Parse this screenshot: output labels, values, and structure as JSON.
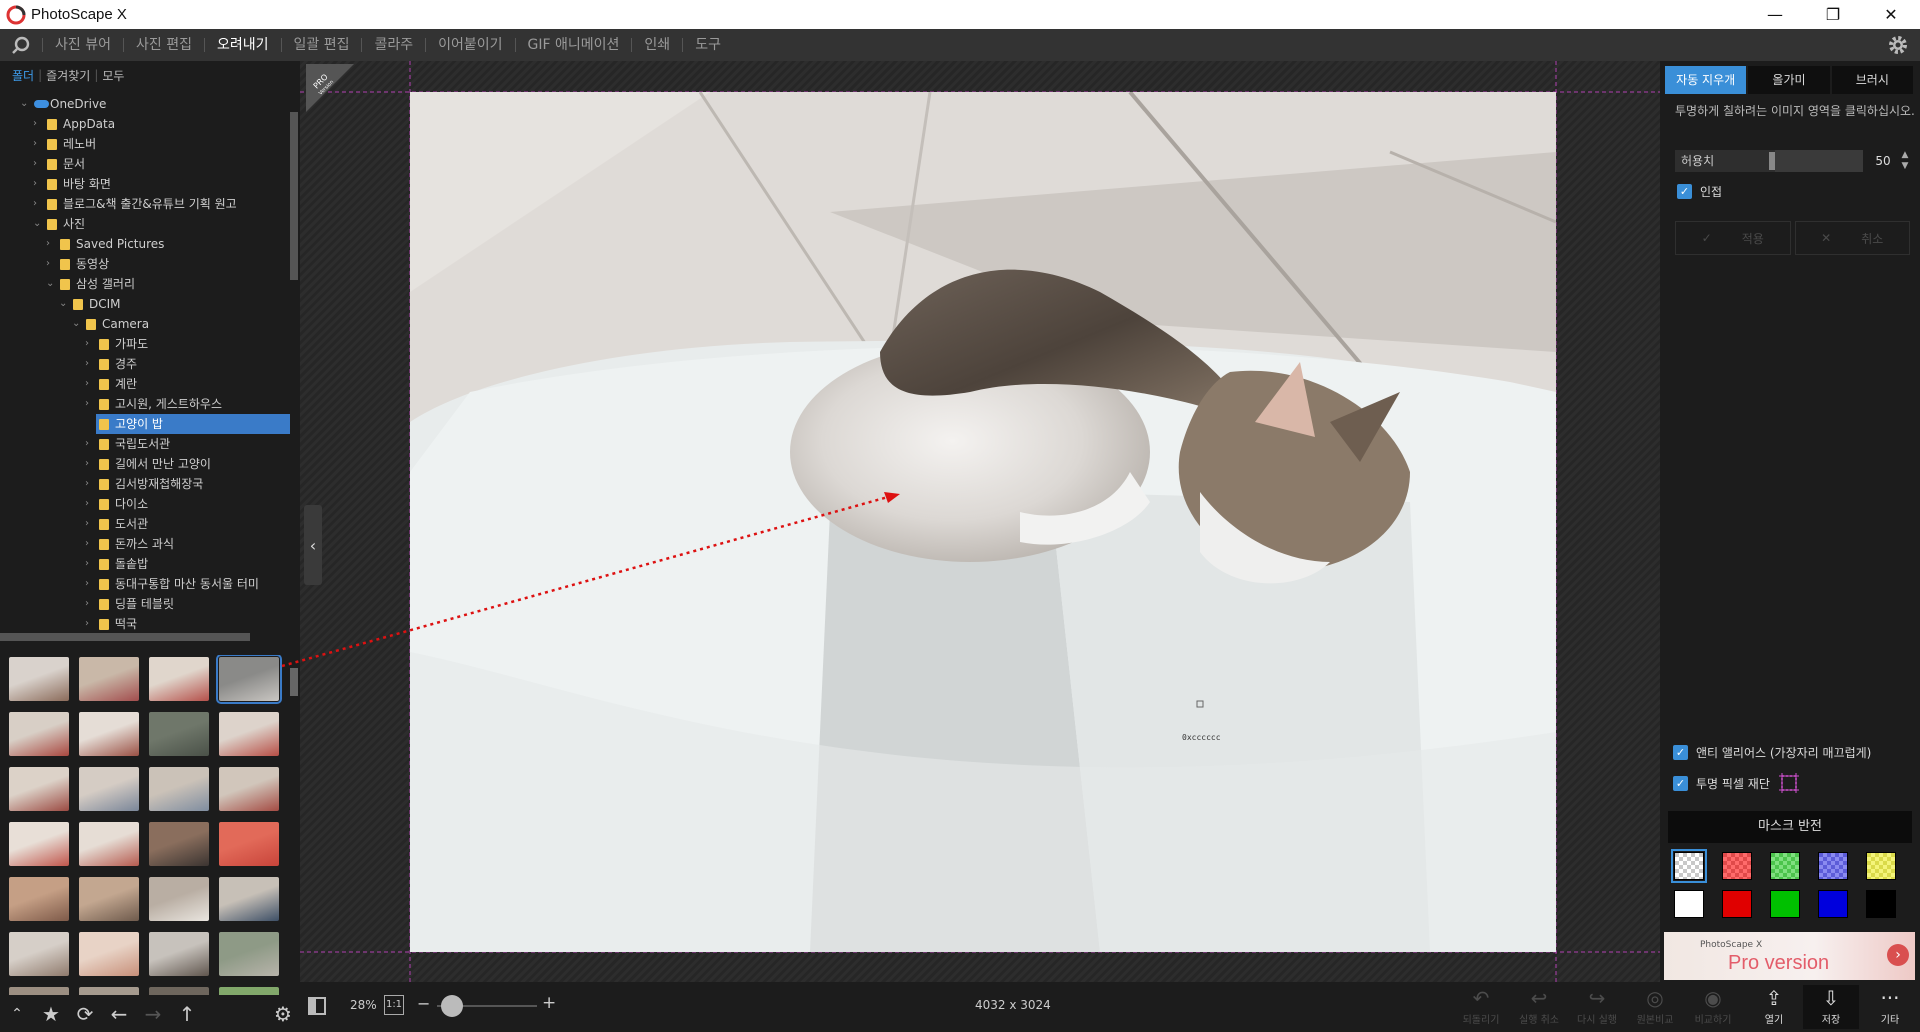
{
  "app": {
    "title": "PhotoScape X"
  },
  "window_buttons": [
    "—",
    "❐",
    "✕"
  ],
  "menu": {
    "items": [
      "사진 뷰어",
      "사진 편집",
      "오려내기",
      "일괄 편집",
      "콜라주",
      "이어붙이기",
      "GIF 애니메이션",
      "인쇄",
      "도구"
    ],
    "active": "오려내기"
  },
  "left_tabs": [
    "폴더",
    "즐겨찾기",
    "모두"
  ],
  "tree": [
    {
      "label": "OneDrive",
      "level": 0,
      "arrow": "⌄",
      "icon": "cloud"
    },
    {
      "label": "AppData",
      "level": 1,
      "arrow": "›",
      "icon": "folder"
    },
    {
      "label": "레노버",
      "level": 1,
      "arrow": "›",
      "icon": "folder"
    },
    {
      "label": "문서",
      "level": 1,
      "arrow": "›",
      "icon": "folder"
    },
    {
      "label": "바탕 화면",
      "level": 1,
      "arrow": "›",
      "icon": "folder"
    },
    {
      "label": "블로그&책 출간&유튜브 기획 원고",
      "level": 1,
      "arrow": "›",
      "icon": "folder"
    },
    {
      "label": "사진",
      "level": 1,
      "arrow": "⌄",
      "icon": "folder"
    },
    {
      "label": "Saved Pictures",
      "level": 2,
      "arrow": "›",
      "icon": "folder"
    },
    {
      "label": "동영상",
      "level": 2,
      "arrow": "›",
      "icon": "folder"
    },
    {
      "label": "삼성 갤러리",
      "level": 2,
      "arrow": "⌄",
      "icon": "folder"
    },
    {
      "label": "DCIM",
      "level": 3,
      "arrow": "⌄",
      "icon": "folder"
    },
    {
      "label": "Camera",
      "level": 4,
      "arrow": "⌄",
      "icon": "folder"
    },
    {
      "label": "가파도",
      "level": 5,
      "arrow": "›",
      "icon": "folder"
    },
    {
      "label": "경주",
      "level": 5,
      "arrow": "›",
      "icon": "folder"
    },
    {
      "label": "계란",
      "level": 5,
      "arrow": "›",
      "icon": "folder"
    },
    {
      "label": "고시원, 게스트하우스",
      "level": 5,
      "arrow": "›",
      "icon": "folder"
    },
    {
      "label": "고양이 밥",
      "level": 5,
      "arrow": "",
      "icon": "folder",
      "selected": true
    },
    {
      "label": "국립도서관",
      "level": 5,
      "arrow": "›",
      "icon": "folder"
    },
    {
      "label": "길에서 만난 고양이",
      "level": 5,
      "arrow": "›",
      "icon": "folder"
    },
    {
      "label": "김서방재첩해장국",
      "level": 5,
      "arrow": "›",
      "icon": "folder"
    },
    {
      "label": "다이소",
      "level": 5,
      "arrow": "›",
      "icon": "folder"
    },
    {
      "label": "도서관",
      "level": 5,
      "arrow": "›",
      "icon": "folder"
    },
    {
      "label": "돈까스 과식",
      "level": 5,
      "arrow": "›",
      "icon": "folder"
    },
    {
      "label": "돌솥밥",
      "level": 5,
      "arrow": "›",
      "icon": "folder"
    },
    {
      "label": "동대구통합 마산 동서울 터미",
      "level": 5,
      "arrow": "›",
      "icon": "folder"
    },
    {
      "label": "딩플 테블릿",
      "level": 5,
      "arrow": "›",
      "icon": "folder"
    },
    {
      "label": "떡국",
      "level": 5,
      "arrow": "›",
      "icon": "folder"
    }
  ],
  "thumbnails": [
    {
      "c1": "#8b6b5a",
      "c2": "#d9d2cc"
    },
    {
      "c1": "#a24d4d",
      "c2": "#c9b8a8"
    },
    {
      "c1": "#b5504a",
      "c2": "#e0d6cc"
    },
    {
      "c1": "#c9c6c2",
      "c2": "#8a8a88",
      "selected": true
    },
    {
      "c1": "#a8473f",
      "c2": "#d8cfc6"
    },
    {
      "c1": "#9a5044",
      "c2": "#e5ddd6"
    },
    {
      "c1": "#4a5148",
      "c2": "#6f776a"
    },
    {
      "c1": "#b74e45",
      "c2": "#ddd3cb"
    },
    {
      "c1": "#9b4a42",
      "c2": "#dcd2c8"
    },
    {
      "c1": "#7a8699",
      "c2": "#d5ccc4"
    },
    {
      "c1": "#7f8da0",
      "c2": "#cbc2b8"
    },
    {
      "c1": "#a44b43",
      "c2": "#d1c6bb"
    },
    {
      "c1": "#c0554b",
      "c2": "#e8dfd7"
    },
    {
      "c1": "#b55a4e",
      "c2": "#e6ddd5"
    },
    {
      "c1": "#3b3431",
      "c2": "#8a6e5d"
    },
    {
      "c1": "#c8443a",
      "c2": "#e26a59"
    },
    {
      "c1": "#7e5a49",
      "c2": "#c59f85"
    },
    {
      "c1": "#6e5a4c",
      "c2": "#c3a790"
    },
    {
      "c1": "#e9e5df",
      "c2": "#b9aea3"
    },
    {
      "c1": "#3d4f66",
      "c2": "#c7c0b7"
    },
    {
      "c1": "#8f7a6c",
      "c2": "#d6cfc8"
    },
    {
      "c1": "#c78f79",
      "c2": "#e8d3c6"
    },
    {
      "c1": "#60564e",
      "c2": "#c7c2bc"
    },
    {
      "c1": "#b8b4ab",
      "c2": "#8e9a86"
    },
    {
      "c1": "#c8bfb3",
      "c2": "#9c8f82"
    },
    {
      "c1": "#c6bdb2",
      "c2": "#a59a8e"
    },
    {
      "c1": "#3a3530",
      "c2": "#6e665d"
    },
    {
      "c1": "#4c7a3e",
      "c2": "#82a86b"
    }
  ],
  "right_tabs": [
    "자동 지우개",
    "올가미",
    "브러시"
  ],
  "hint": "투명하게 칠하려는 이미지 영역을 클릭하십시오.",
  "tolerance": {
    "label": "허용치",
    "value": "50",
    "level": 0.5
  },
  "adjacent_label": "인접",
  "apply_label": "적용",
  "cancel_label": "취소",
  "antialias_label": "앤티 앨리어스 (가장자리 매끄럽게)",
  "transparent_crop_label": "투명 픽셀 재단",
  "mask_invert_label": "마스크 반전",
  "swatches": [
    "checker-white",
    "checker-red",
    "checker-green",
    "checker-blue",
    "checker-yellow",
    "#ffffff",
    "#e00000",
    "#00c000",
    "#0000dd",
    "#000000"
  ],
  "pro_banner": {
    "small": "PhotoScape X",
    "big": "Pro version"
  },
  "pro_badge": {
    "line1": "PRO",
    "line2": "Version"
  },
  "color_readout": "0xcccccc",
  "bottom": {
    "zoom": "28%",
    "one_to_one": "1:1",
    "image_size": "4032 x 3024",
    "tools": [
      {
        "label": "되돌리기",
        "icon": "↶",
        "state": "dim"
      },
      {
        "label": "실행 취소",
        "icon": "↩",
        "state": "dim"
      },
      {
        "label": "다시 실행",
        "icon": "↪",
        "state": "dim"
      },
      {
        "label": "원본비교",
        "icon": "◎",
        "state": "dim"
      },
      {
        "label": "비교하기",
        "icon": "◉",
        "state": "dim"
      },
      {
        "label": "열기",
        "icon": "⇪",
        "state": "on"
      },
      {
        "label": "저장",
        "icon": "⇩",
        "state": "on"
      },
      {
        "label": "기타",
        "icon": "···",
        "state": "on"
      }
    ]
  },
  "colors": {
    "accent": "#3a8fd8",
    "panel": "#1c1c1c",
    "menu": "#333333",
    "guide": "#c040c0"
  }
}
